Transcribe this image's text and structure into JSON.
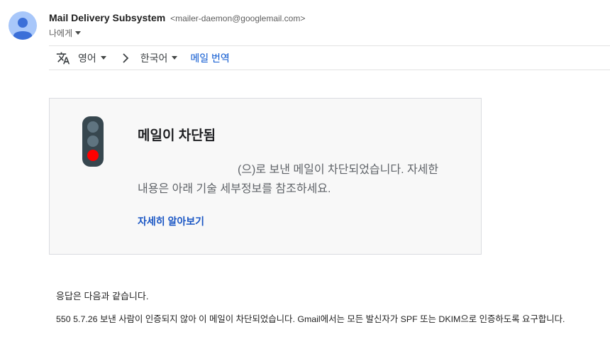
{
  "header": {
    "sender_name": "Mail Delivery Subsystem",
    "sender_email": "<mailer-daemon@googlemail.com>",
    "recipient": "나에게"
  },
  "translate_bar": {
    "source_language": "영어",
    "target_language": "한국어",
    "translate_action": "메일 번역"
  },
  "notice": {
    "title": "메일이 차단됨",
    "body_line1": "(으)로 보낸 메일이 차단되었습니다. 자세한",
    "body_line2": "내용은 아래 기술 세부정보를 참조하세요.",
    "learn_more": "자세히 알아보기",
    "signal_colors": {
      "housing": "#37474f",
      "off": "#5f7480",
      "active": "#ff0000"
    }
  },
  "response": {
    "intro": "응답은 다음과 같습니다.",
    "detail": "550 5.7.26 보낸 사람이 인증되지 않아 이 메일이 차단되었습니다. Gmail에서는 모든 발신자가 SPF 또는 DKIM으로 인증하도록 요구합니다."
  },
  "colors": {
    "link": "#0b57d0",
    "card_background": "#f8f8f8"
  }
}
